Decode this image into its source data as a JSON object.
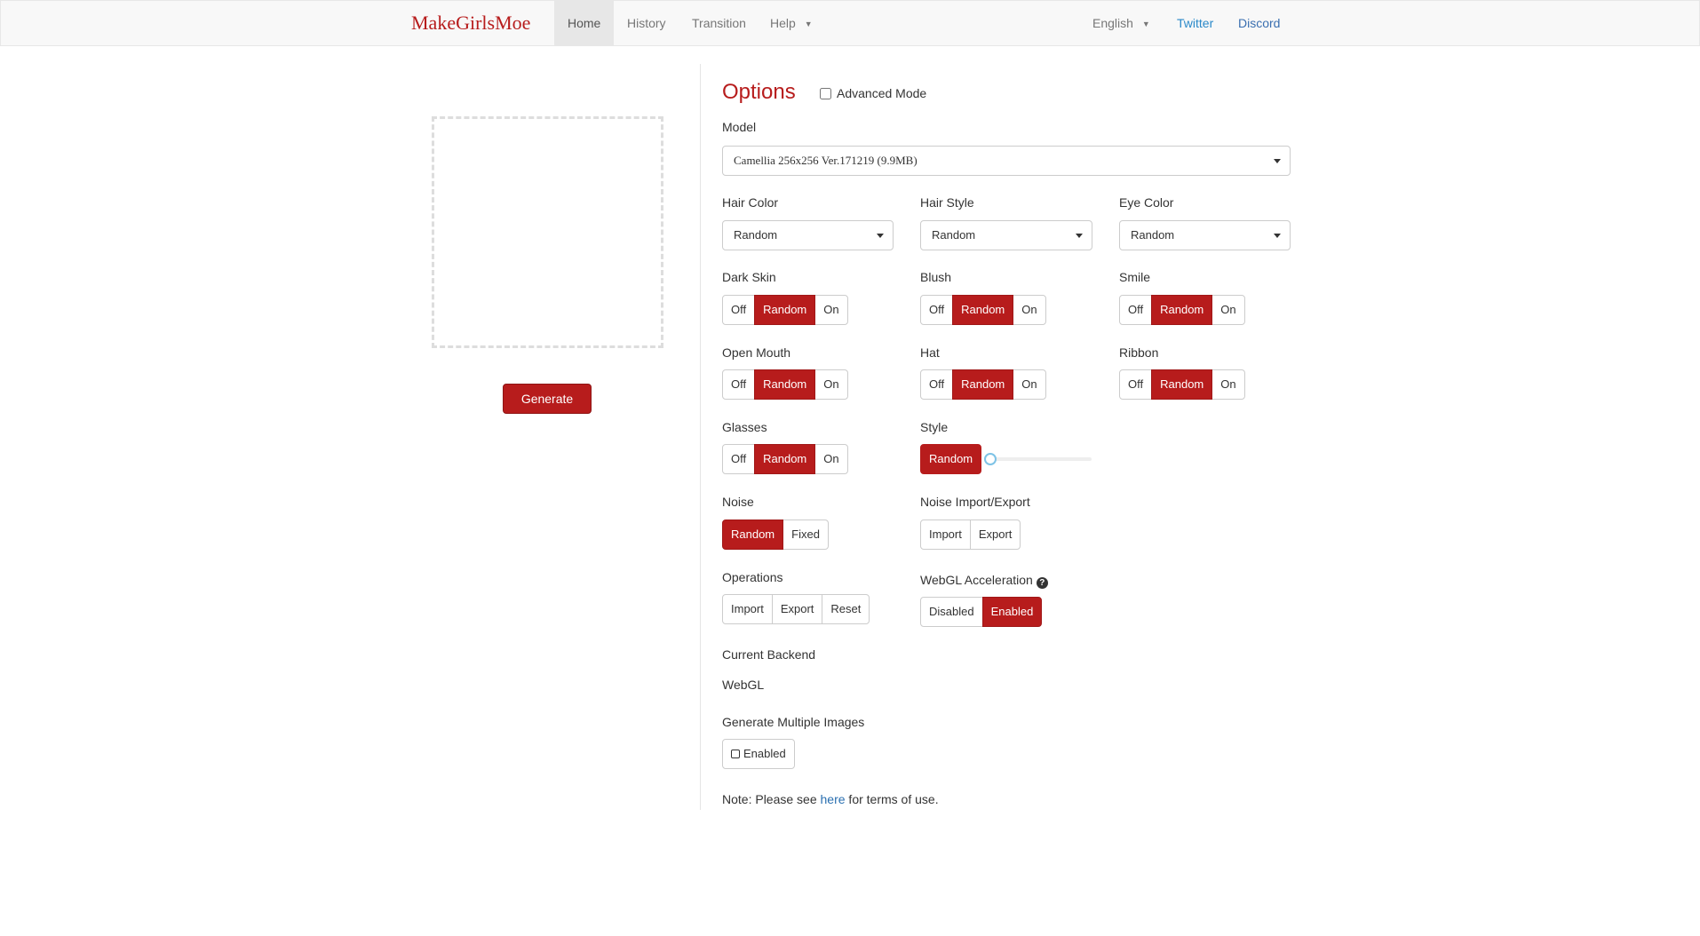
{
  "nav": {
    "brand": "MakeGirlsMoe",
    "items": [
      {
        "label": "Home"
      },
      {
        "label": "History"
      },
      {
        "label": "Transition"
      },
      {
        "label": "Help"
      }
    ],
    "language": "English",
    "twitter": "Twitter",
    "discord": "Discord"
  },
  "left": {
    "generate_label": "Generate"
  },
  "options": {
    "title": "Options",
    "advanced_mode": "Advanced Mode",
    "model_label": "Model",
    "model_value": "Camellia 256x256 Ver.171219 (9.9MB)",
    "hair_color_label": "Hair Color",
    "hair_color_value": "Random",
    "hair_style_label": "Hair Style",
    "hair_style_value": "Random",
    "eye_color_label": "Eye Color",
    "eye_color_value": "Random",
    "toggles": {
      "off": "Off",
      "random": "Random",
      "on": "On"
    },
    "dark_skin_label": "Dark Skin",
    "blush_label": "Blush",
    "smile_label": "Smile",
    "open_mouth_label": "Open Mouth",
    "hat_label": "Hat",
    "ribbon_label": "Ribbon",
    "glasses_label": "Glasses",
    "style_label": "Style",
    "style_random": "Random",
    "noise_label": "Noise",
    "noise_random": "Random",
    "noise_fixed": "Fixed",
    "noise_ie_label": "Noise Import/Export",
    "import": "Import",
    "export": "Export",
    "reset": "Reset",
    "operations_label": "Operations",
    "webgl_label": "WebGL Acceleration",
    "webgl_disabled": "Disabled",
    "webgl_enabled": "Enabled",
    "backend_label": "Current Backend",
    "backend_value": "WebGL",
    "multi_label": "Generate Multiple Images",
    "multi_enabled": "Enabled",
    "note_prefix": "Note: Please see ",
    "note_link": "here",
    "note_suffix": " for terms of use."
  },
  "colors": {
    "accent": "#b71c1c",
    "link": "#2a89c9"
  }
}
